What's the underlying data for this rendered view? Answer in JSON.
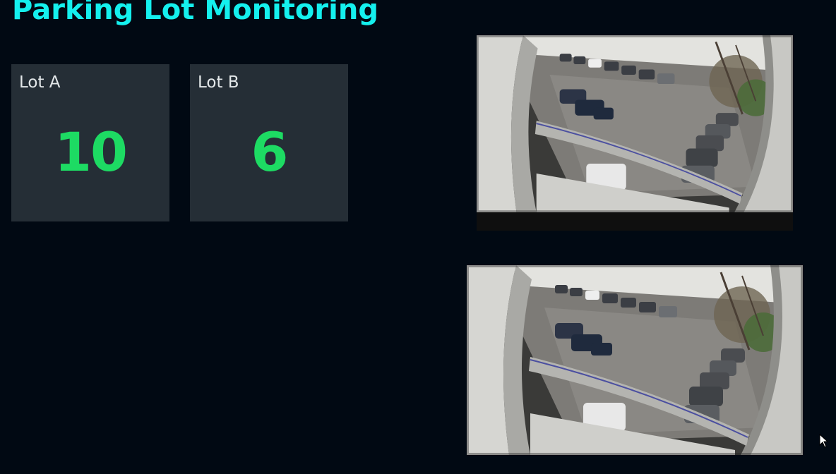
{
  "page": {
    "title": "Parking Lot Monitoring"
  },
  "lots": [
    {
      "label": "Lot A",
      "count": "10"
    },
    {
      "label": "Lot B",
      "count": "6"
    }
  ],
  "colors": {
    "background": "#010913",
    "title": "#14f0ee",
    "tile_background": "#252e36",
    "tile_label": "#e4e8ea",
    "count": "#1ddb63"
  },
  "icons": {
    "pointer": "mouse-pointer-icon"
  }
}
